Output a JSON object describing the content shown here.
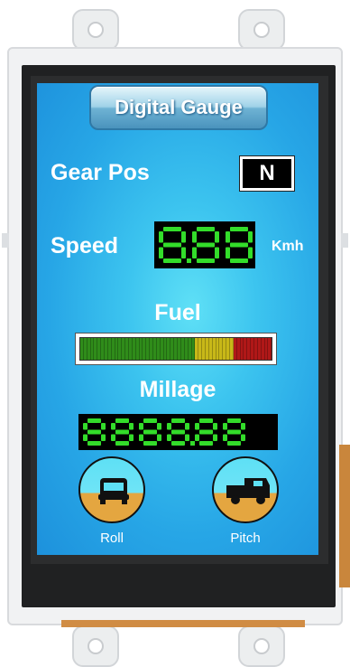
{
  "title_button": {
    "label": "Digital Gauge"
  },
  "gear": {
    "label": "Gear Pos",
    "value": "N"
  },
  "speed": {
    "label": "Speed",
    "unit": "Kmh",
    "display": "8.88"
  },
  "fuel": {
    "label": "Fuel",
    "level": 1.0
  },
  "millage": {
    "label": "Millage",
    "display": "8888.88"
  },
  "roll": {
    "label": "Roll"
  },
  "pitch": {
    "label": "Pitch"
  },
  "colors": {
    "screen_bg": "#27a6e6",
    "segment_on": "#33dd2a",
    "fuel_green": "#2f8c1a",
    "fuel_yellow": "#c8b818",
    "fuel_red": "#b01818",
    "horizon_sky": "#5ee0f5",
    "horizon_ground": "#e4a640"
  },
  "icons": {
    "roll": "vehicle-front-icon",
    "pitch": "vehicle-side-icon"
  }
}
